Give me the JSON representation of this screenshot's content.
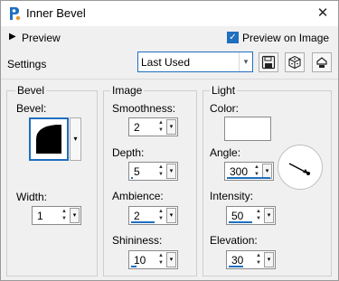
{
  "window": {
    "title": "Inner Bevel",
    "close_glyph": "✕"
  },
  "preview": {
    "label": "Preview",
    "arrow": "▶",
    "preview_on_image_label": "Preview on Image",
    "preview_on_image_checked": true,
    "check_glyph": "✓"
  },
  "settings": {
    "label": "Settings",
    "preset_value": "Last Used",
    "dropdown_glyph": "▾",
    "buttons": [
      "save-preset-icon",
      "randomize-dice-icon",
      "reset-icon"
    ]
  },
  "bevel": {
    "group_label": "Bevel",
    "bevel_label": "Bevel:",
    "width_label": "Width:",
    "width_value": "1"
  },
  "image": {
    "group_label": "Image",
    "smoothness_label": "Smoothness:",
    "smoothness_value": "2",
    "depth_label": "Depth:",
    "depth_value": "5",
    "ambience_label": "Ambience:",
    "ambience_value": "2",
    "shininess_label": "Shininess:",
    "shininess_value": "10"
  },
  "light": {
    "group_label": "Light",
    "color_label": "Color:",
    "color_value": "#ffffff",
    "angle_label": "Angle:",
    "angle_value": "300",
    "intensity_label": "Intensity:",
    "intensity_value": "50",
    "elevation_label": "Elevation:",
    "elevation_value": "30"
  },
  "colors": {
    "accent": "#1f6fbf"
  }
}
